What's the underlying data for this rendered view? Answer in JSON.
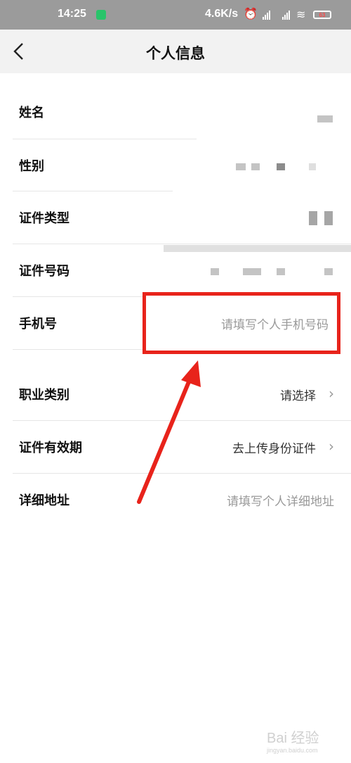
{
  "status_bar": {
    "time": "14:25",
    "network_speed": "4.6K/s",
    "battery": "63"
  },
  "header": {
    "title": "个人信息"
  },
  "form": {
    "name_label": "姓名",
    "gender_label": "性别",
    "id_type_label": "证件类型",
    "id_number_label": "证件号码",
    "phone_label": "手机号",
    "phone_placeholder": "请填写个人手机号码",
    "occupation_label": "职业类别",
    "occupation_value": "请选择",
    "id_validity_label": "证件有效期",
    "id_validity_value": "去上传身份证件",
    "address_label": "详细地址",
    "address_placeholder": "请填写个人详细地址"
  },
  "watermark": {
    "text": "Bai 经验",
    "sub": "jingyan.baidu.com"
  },
  "colors": {
    "highlight": "#e8231b",
    "status_bar": "#9b9b9b",
    "nav_bar": "#f2f2f2",
    "placeholder": "#999999"
  }
}
